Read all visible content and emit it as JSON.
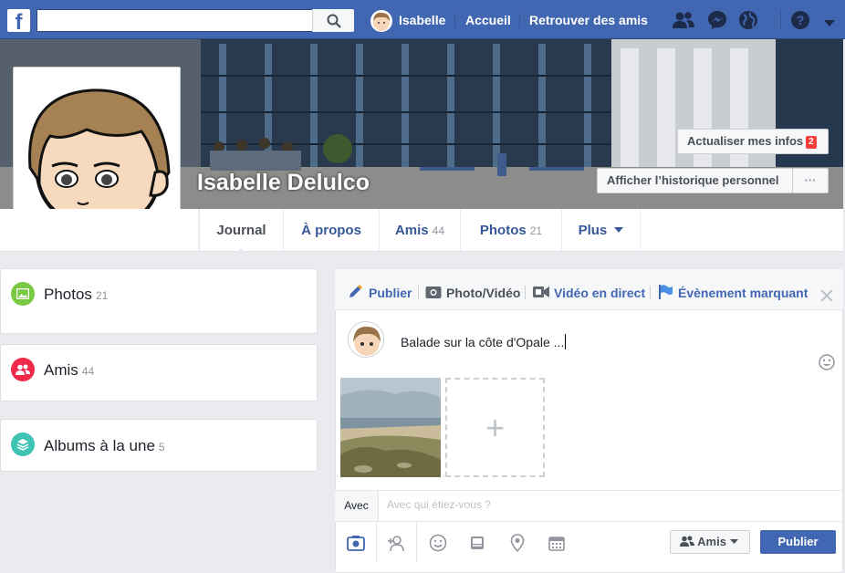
{
  "topbar": {
    "search": {
      "value": "",
      "placeholder": ""
    },
    "user_name": "Isabelle",
    "home": "Accueil",
    "find_friends": "Retrouver des amis",
    "icons": [
      "friend-requests-icon",
      "messenger-icon",
      "notifications-globe-icon",
      "help-icon",
      "caret-down-icon"
    ]
  },
  "cover": {
    "profile_name": "Isabelle Delulco",
    "update_info": "Actualiser mes infos",
    "update_badge": "2",
    "activity_log": "Afficher l’historique personnel",
    "more": "···"
  },
  "tabs": [
    {
      "label": "Journal",
      "count": ""
    },
    {
      "label": "À propos",
      "count": ""
    },
    {
      "label": "Amis",
      "count": "44"
    },
    {
      "label": "Photos",
      "count": "21"
    },
    {
      "label": "Plus",
      "count": ""
    }
  ],
  "left_cards": [
    {
      "label": "Photos",
      "count": "21",
      "icon": "photos-icon",
      "color": "#7ac943"
    },
    {
      "label": "Amis",
      "count": "44",
      "icon": "friends-icon",
      "color": "#f02849"
    },
    {
      "label": "Albums à la une",
      "count": "5",
      "icon": "albums-icon",
      "color": "#3fc4b3"
    }
  ],
  "composer": {
    "tabs": [
      "Publier",
      "Photo/Vidéo",
      "Vidéo en direct",
      "Évènement marquant"
    ],
    "text": "Balade sur la côte d'Opale ...",
    "add_photo": "+",
    "with_label": "Avec",
    "with_placeholder": "Avec qui étiez-vous ?",
    "audience": "Amis",
    "publish": "Publier"
  },
  "colors": {
    "brand": "#4267b2",
    "badge": "#fa3e3e"
  }
}
